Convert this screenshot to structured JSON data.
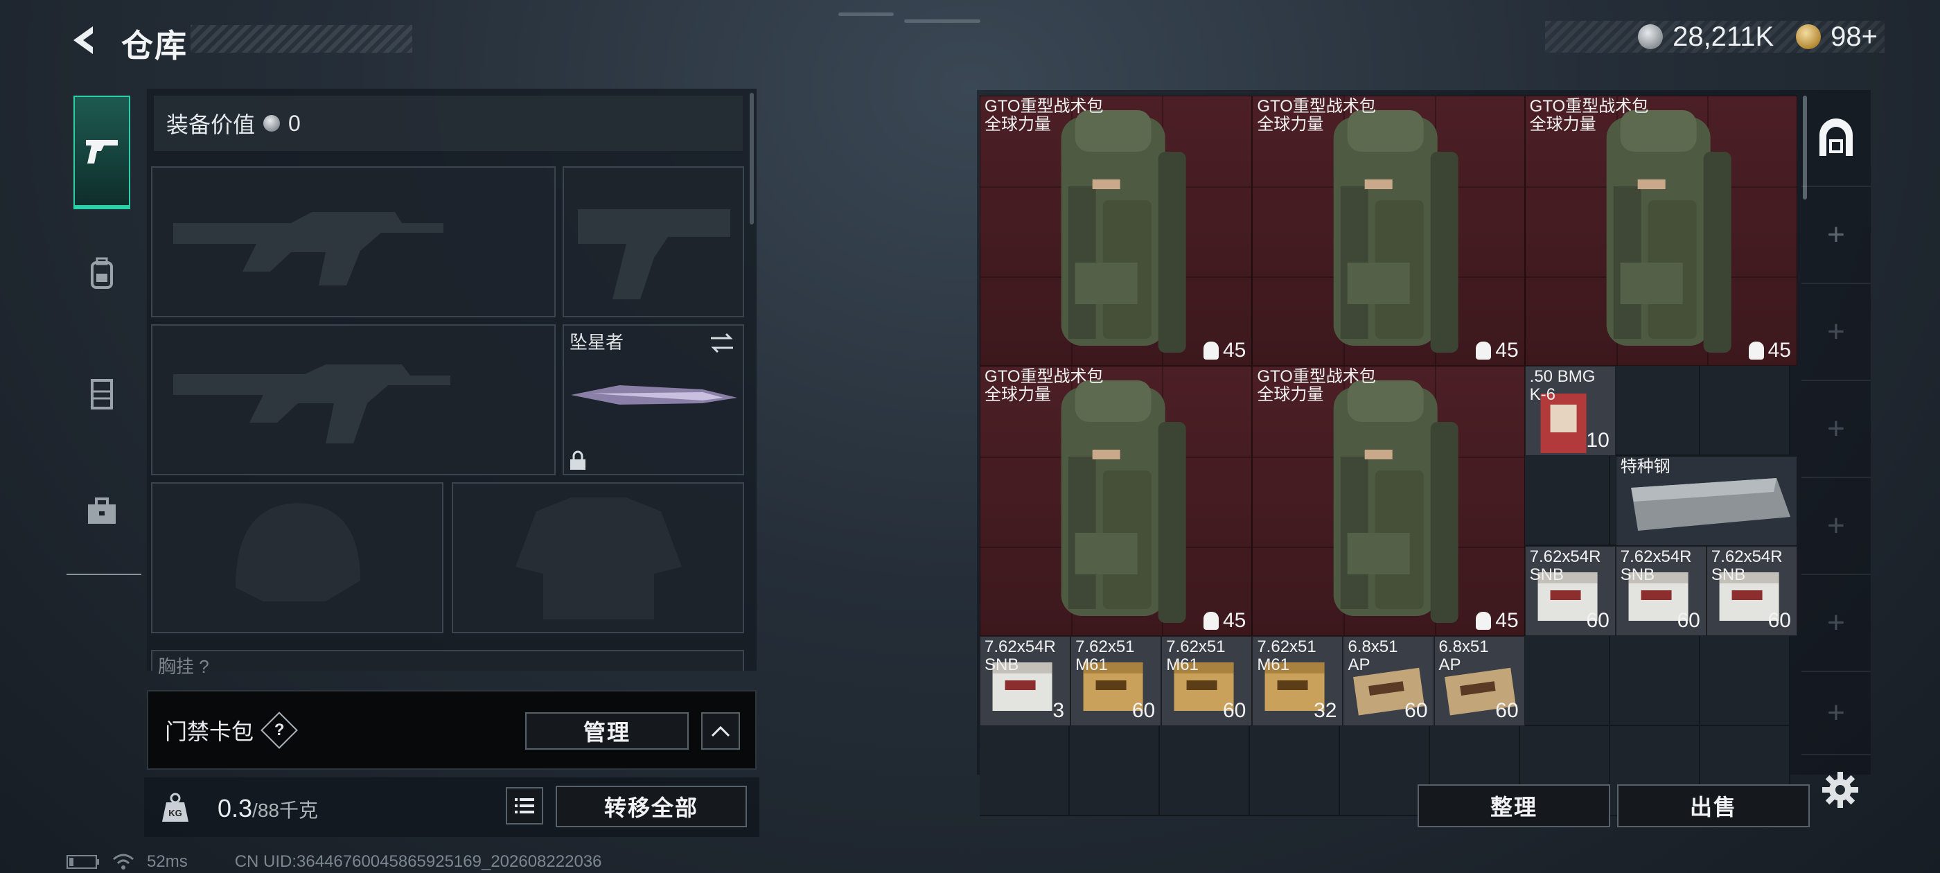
{
  "header": {
    "title": "仓库",
    "back_icon": "back-arrow-icon",
    "currency": [
      {
        "icon": "silver-coin-icon",
        "value": "28,211K"
      },
      {
        "icon": "gold-coin-icon",
        "value": "98+"
      }
    ]
  },
  "categories": [
    {
      "icon": "pistol-icon",
      "active": true
    },
    {
      "icon": "backpack-icon",
      "active": false
    },
    {
      "icon": "vest-icon",
      "active": false
    },
    {
      "icon": "briefcase-icon",
      "active": false
    }
  ],
  "equipment": {
    "value_label": "装备价值",
    "value": "0",
    "melee_name": "坠星者",
    "partial_slot_label": "胸挂 ?"
  },
  "keycard": {
    "label": "门禁卡包",
    "help": "?",
    "manage_label": "管理"
  },
  "weight": {
    "current": "0.3",
    "capacity": "/88千克",
    "transfer_all_label": "转移全部"
  },
  "status": {
    "ping": "52ms",
    "uid": "CN UID:3644676004586592516​9_202608222036"
  },
  "storage": {
    "items": [
      {
        "name": "GTO重型战术包\n全球力量",
        "qty": "45",
        "kind": "backpack"
      },
      {
        "name": "GTO重型战术包\n全球力量",
        "qty": "45",
        "kind": "backpack"
      },
      {
        "name": "GTO重型战术包\n全球力量",
        "qty": "45",
        "kind": "backpack"
      },
      {
        "name": "GTO重型战术包\n全球力量",
        "qty": "45",
        "kind": "backpack"
      },
      {
        "name": "GTO重型战术包\n全球力量",
        "qty": "45",
        "kind": "backpack"
      },
      {
        "name": ".50 BMG\nK-6",
        "qty": "10",
        "kind": "ammo-red"
      },
      {
        "name": "特种钢",
        "qty": "",
        "kind": "steel"
      },
      {
        "name": "7.62x54R\nSNB",
        "qty": "60",
        "kind": "ammo-white"
      },
      {
        "name": "7.62x54R\nSNB",
        "qty": "60",
        "kind": "ammo-white"
      },
      {
        "name": "7.62x54R\nSNB",
        "qty": "60",
        "kind": "ammo-white"
      },
      {
        "name": "7.62x54R\nSNB",
        "qty": "3",
        "kind": "ammo-white"
      },
      {
        "name": "7.62x51\nM61",
        "qty": "60",
        "kind": "ammo-gold"
      },
      {
        "name": "7.62x51\nM61",
        "qty": "60",
        "kind": "ammo-gold"
      },
      {
        "name": "7.62x51\nM61",
        "qty": "32",
        "kind": "ammo-gold"
      },
      {
        "name": "6.8x51\nAP",
        "qty": "60",
        "kind": "ammo-tan"
      },
      {
        "name": "6.8x51\nAP",
        "qty": "60",
        "kind": "ammo-tan"
      }
    ],
    "sort_label": "整理",
    "sell_label": "出售"
  },
  "side_rail": [
    {
      "icon": "warehouse-icon",
      "active": true
    },
    {
      "icon": "plus-icon",
      "active": false
    },
    {
      "icon": "plus-icon",
      "active": false
    },
    {
      "icon": "plus-icon",
      "active": false
    },
    {
      "icon": "plus-icon",
      "active": false
    },
    {
      "icon": "plus-icon",
      "active": false
    },
    {
      "icon": "plus-icon",
      "active": false
    }
  ],
  "settings_icon": "gear-icon",
  "colors": {
    "accent": "#2bd0a8",
    "equipped_red": "#4a1d22",
    "cell_dark": "#1d242c"
  }
}
